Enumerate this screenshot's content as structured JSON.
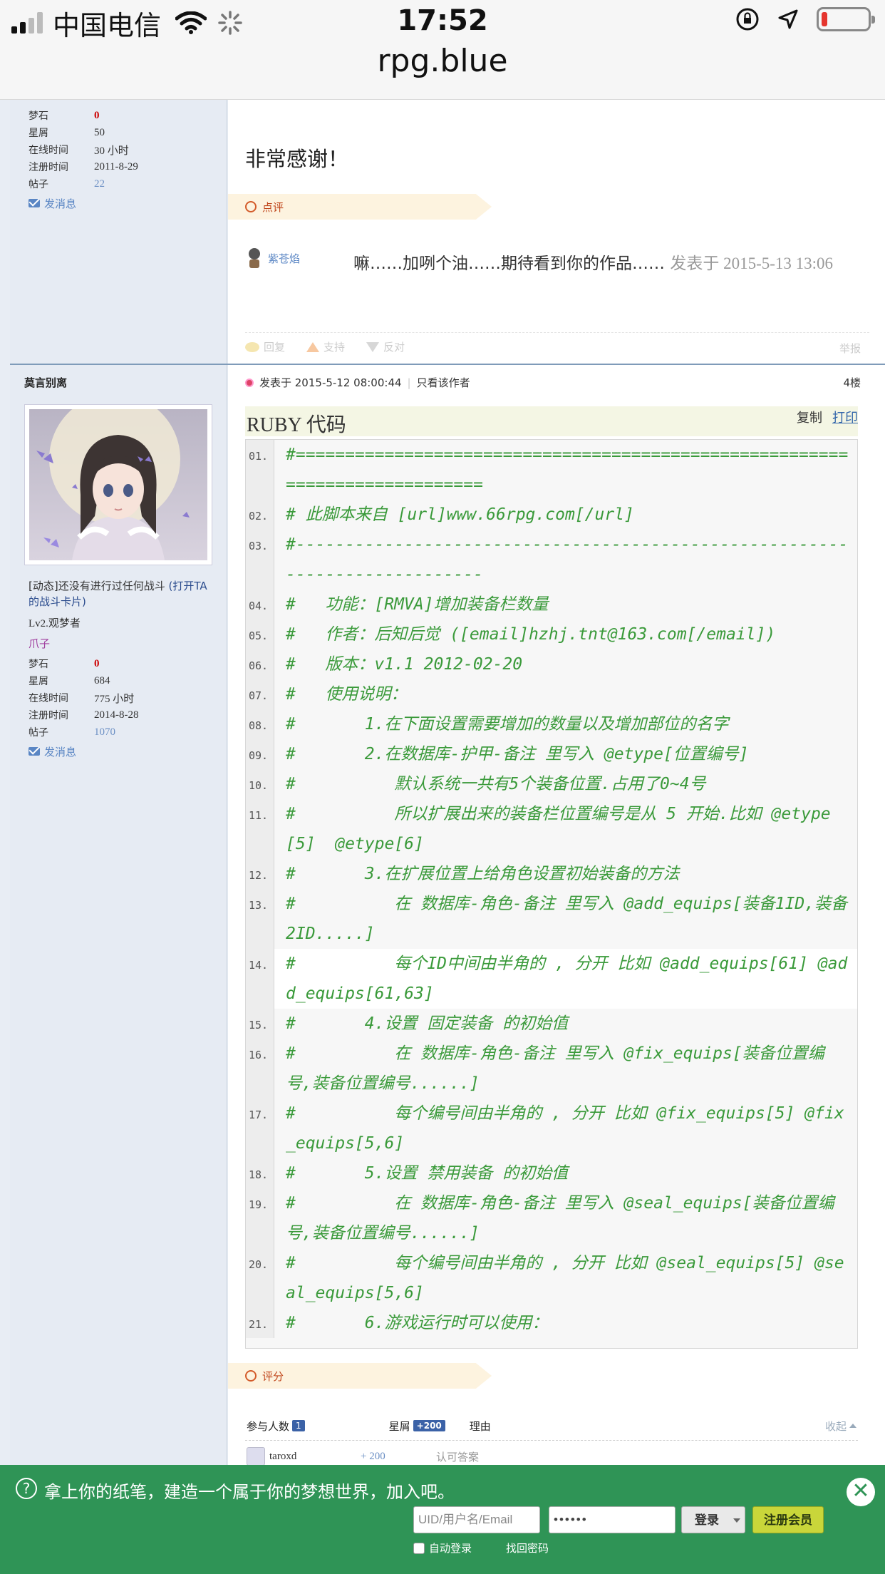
{
  "status_bar": {
    "carrier": "中国电信",
    "time": "17:52",
    "url": "rpg.blue"
  },
  "post_a": {
    "user_stats": [
      {
        "label": "梦石",
        "value": "0"
      },
      {
        "label": "星屑",
        "value": "50"
      },
      {
        "label": "在线时间",
        "value": "30 小时"
      },
      {
        "label": "注册时间",
        "value": "2011-8-29"
      },
      {
        "label": "帖子",
        "value": "22"
      }
    ],
    "send_message": "发消息",
    "body": "非常感谢！",
    "comment_tab": "点评",
    "comment": {
      "user": "紫苍焰",
      "text": "嘛……加咧个油……期待看到你的作品……",
      "time": "发表于 2015-5-13 13:06"
    },
    "actions": {
      "reply": "回复",
      "support": "支持",
      "oppose": "反对",
      "report": "举报"
    }
  },
  "post_b": {
    "username": "莫言别离",
    "dynamic": "[动态]还没有进行过任何战斗",
    "battle_card": "(打开TA的战斗卡片)",
    "level": "Lv2.观梦者",
    "title": "爪子",
    "user_stats": [
      {
        "label": "梦石",
        "value": "0"
      },
      {
        "label": "星屑",
        "value": "684"
      },
      {
        "label": "在线时间",
        "value": "775 小时"
      },
      {
        "label": "注册时间",
        "value": "2014-8-28"
      },
      {
        "label": "帖子",
        "value": "1070"
      }
    ],
    "send_message": "发消息",
    "posted_at": "发表于 2015-5-12 08:00:44",
    "author_only": "只看该作者",
    "floor": "4楼",
    "code_title": "RUBY 代码",
    "copy": "复制",
    "print": "打印",
    "code_lines": [
      {
        "n": "01.",
        "t": "#============================================================================"
      },
      {
        "n": "02.",
        "t": "# 此脚本来自 [url]www.66rpg.com[/url]"
      },
      {
        "n": "03.",
        "t": "#----------------------------------------------------------------------------"
      },
      {
        "n": "04.",
        "t": "#   功能：[RMVA]增加装备栏数量"
      },
      {
        "n": "05.",
        "t": "#   作者：后知后觉 ([email]hzhj.tnt@163.com[/email])"
      },
      {
        "n": "06.",
        "t": "#   版本：v1.1 2012-02-20"
      },
      {
        "n": "07.",
        "t": "#   使用说明："
      },
      {
        "n": "08.",
        "t": "#       1.在下面设置需要增加的数量以及增加部位的名字"
      },
      {
        "n": "09.",
        "t": "#       2.在数据库-护甲-备注 里写入 @etype[位置编号]"
      },
      {
        "n": "10.",
        "t": "#          默认系统一共有5个装备位置.占用了0~4号"
      },
      {
        "n": "11.",
        "t": "#          所以扩展出来的装备栏位置编号是从 5 开始.比如 @etype[5]  @etype[6]"
      },
      {
        "n": "12.",
        "t": "#       3.在扩展位置上给角色设置初始装备的方法"
      },
      {
        "n": "13.",
        "t": "#          在 数据库-角色-备注 里写入 @add_equips[装备1ID,装备2ID.....]"
      },
      {
        "n": "14.",
        "t": "#          每个ID中间由半角的 , 分开 比如 @add_equips[61] @add_equips[61,63]"
      },
      {
        "n": "15.",
        "t": "#       4.设置 固定装备 的初始值"
      },
      {
        "n": "16.",
        "t": "#          在 数据库-角色-备注 里写入 @fix_equips[装备位置编号,装备位置编号......]"
      },
      {
        "n": "17.",
        "t": "#          每个编号间由半角的 , 分开 比如 @fix_equips[5] @fix_equips[5,6]"
      },
      {
        "n": "18.",
        "t": "#       5.设置 禁用装备 的初始值"
      },
      {
        "n": "19.",
        "t": "#          在 数据库-角色-备注 里写入 @seal_equips[装备位置编号,装备位置编号......]"
      },
      {
        "n": "20.",
        "t": "#          每个编号间由半角的 , 分开 比如 @seal_equips[5] @seal_equips[5,6]"
      },
      {
        "n": "21.",
        "t": "#       6.游戏运行时可以使用："
      }
    ],
    "rating_tab": "评分",
    "rating": {
      "participants_label": "参与人数",
      "participants": "1",
      "stars_label": "星屑",
      "stars_total": "+200",
      "reason_label": "理由",
      "collapse": "收起",
      "rows": [
        {
          "user": "taroxd",
          "stars": "+ 200",
          "reason": "认可答案"
        }
      ]
    }
  },
  "footer": {
    "message": "拿上你的纸笔，建造一个属于你的梦想世界，加入吧。",
    "uid_placeholder": "UID/用户名/Email",
    "password_mask": "••••••",
    "login": "登录",
    "register": "注册会员",
    "auto_login": "自动登录",
    "forgot": "找回密码"
  }
}
